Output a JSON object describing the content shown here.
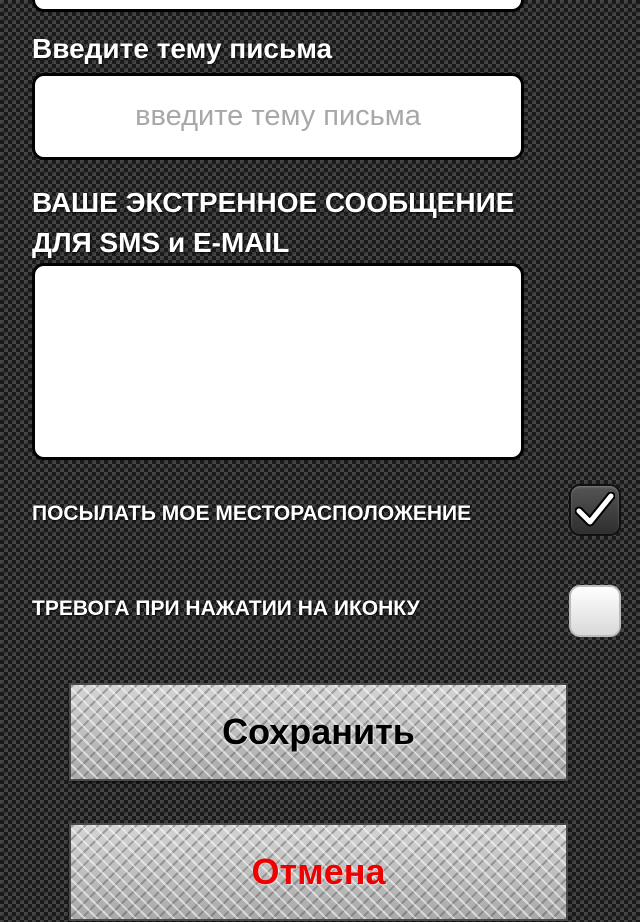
{
  "subject": {
    "label": "Введите тему письма",
    "placeholder": "введите тему письма",
    "value": ""
  },
  "message": {
    "label_line1": "ВАШЕ ЭКСТРЕННОЕ СООБЩЕНИЕ",
    "label_line2": "ДЛЯ SMS и E-MAIL",
    "value": ""
  },
  "options": {
    "send_location_label": "ПОСЫЛАТЬ МОЕ МЕСТОРАСПОЛОЖЕНИЕ",
    "send_location_checked": true,
    "icon_alarm_label": "ТРЕВОГА ПРИ НАЖАТИИ НА ИКОНКУ",
    "icon_alarm_checked": false
  },
  "buttons": {
    "save_label": "Сохранить",
    "cancel_label": "Отмена"
  },
  "colors": {
    "cancel_text": "#ee0000",
    "save_text": "#000000"
  }
}
